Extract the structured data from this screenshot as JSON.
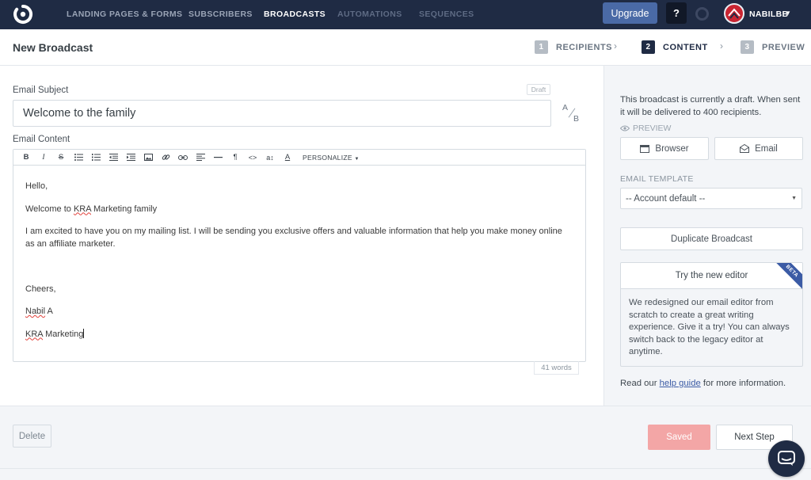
{
  "nav": {
    "items": [
      "LANDING PAGES & FORMS",
      "SUBSCRIBERS",
      "BROADCASTS",
      "AUTOMATIONS",
      "SEQUENCES"
    ],
    "active": "BROADCASTS",
    "upgrade_label": "Upgrade",
    "help_label": "?",
    "username": "NABILBB"
  },
  "header": {
    "title": "New Broadcast",
    "steps": [
      {
        "num": "1",
        "label": "RECIPIENTS"
      },
      {
        "num": "2",
        "label": "CONTENT"
      },
      {
        "num": "3",
        "label": "PREVIEW"
      }
    ],
    "active_step": "CONTENT"
  },
  "editor": {
    "subject_label": "Email Subject",
    "draft_badge": "Draft",
    "subject_value": "Welcome to the family",
    "ab_a": "A",
    "ab_b": "B",
    "content_label": "Email Content",
    "toolbar_icons": [
      "bold-icon",
      "italic-icon",
      "strikethrough-icon",
      "bullet-list-icon",
      "numbered-list-icon",
      "outdent-icon",
      "indent-icon",
      "image-icon",
      "link-icon",
      "unlink-icon",
      "align-icon",
      "horizontal-rule-icon",
      "paragraph-icon",
      "code-icon",
      "font-size-icon",
      "text-color-icon"
    ],
    "personalize_label": "PERSONALIZE",
    "body": {
      "greeting": "Hello,",
      "line2_pre": "Welcome to ",
      "line2_spell": "KRA",
      "line2_post": " Marketing family",
      "line3": "I am excited to have you on my mailing list. I will be sending you exclusive offers and valuable information that help you make money online as an affiliate marketer.",
      "closing": "Cheers,",
      "sig1_spell": "Nabil",
      "sig1_post": " A",
      "sig2_spell": "KRA",
      "sig2_post": " Marketing"
    },
    "word_count": "41 words"
  },
  "sidebar": {
    "info_text": "This broadcast is currently a draft. When sent it will be delivered to 400 recipients.",
    "preview_label": "PREVIEW",
    "browser_label": "Browser",
    "email_label": "Email",
    "template_label": "EMAIL TEMPLATE",
    "template_value": "-- Account default --",
    "duplicate_label": "Duplicate Broadcast",
    "new_editor_title": "Try the new editor",
    "beta_label": "BETA",
    "new_editor_text": "We redesigned our email editor from scratch to create a great writing experience. Give it a try! You can always switch back to the legacy editor at anytime.",
    "help_pre": "Read our ",
    "help_link": "help guide",
    "help_post": " for more information."
  },
  "footer": {
    "delete_label": "Delete",
    "saved_label": "Saved",
    "next_label": "Next Step"
  },
  "colors": {
    "nav_bg": "#1f2b44",
    "upgrade_bg": "#4a6aa6",
    "saved_bg": "#f3a6a6",
    "link": "#3b5ba5"
  }
}
